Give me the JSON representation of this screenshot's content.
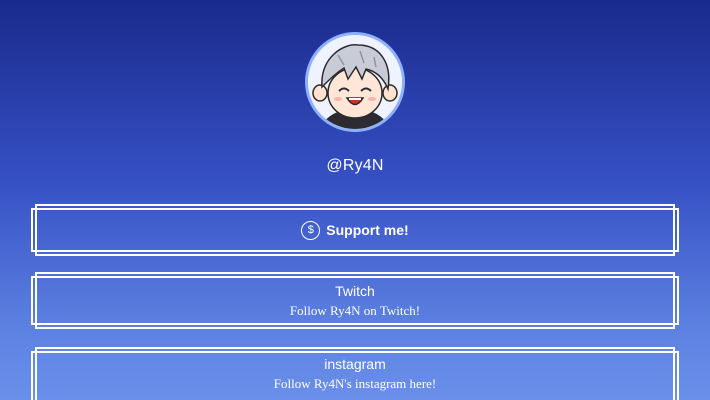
{
  "profile": {
    "handle": "@Ry4N",
    "avatar_icon": "chibi-avatar-icon"
  },
  "links": {
    "support": {
      "icon": "dollar-icon",
      "icon_glyph": "$",
      "label": "Support me!"
    },
    "twitch": {
      "title": "Twitch",
      "subtitle": "Follow Ry4N on Twitch!"
    },
    "instagram": {
      "title": "instagram",
      "subtitle": "Follow Ry4N's instagram here!"
    }
  },
  "colors": {
    "background_top": "#1a2a8c",
    "background_bottom": "#6a90ea",
    "avatar_ring": "#8fb0ff",
    "text": "#ffffff"
  }
}
